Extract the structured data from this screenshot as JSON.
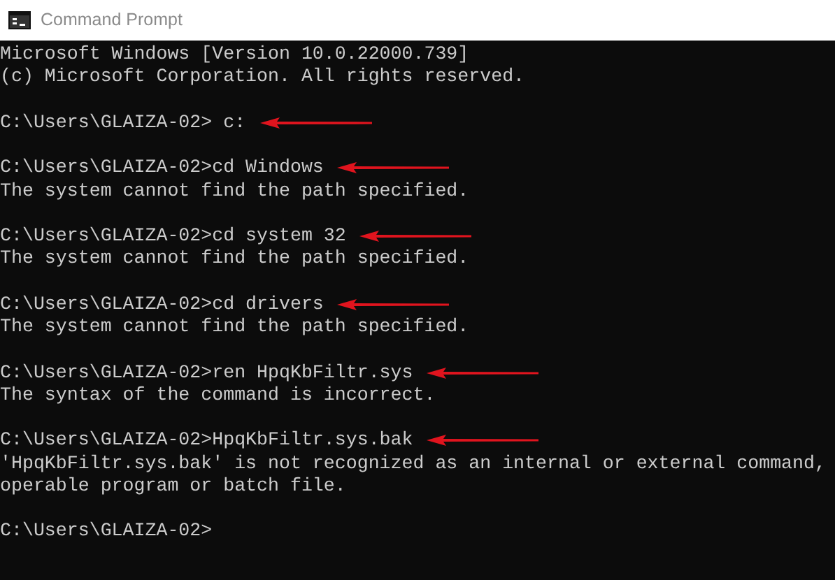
{
  "window": {
    "title": "Command Prompt"
  },
  "console": {
    "lines": [
      {
        "kind": "output",
        "text": "Microsoft Windows [Version 10.0.22000.739]",
        "arrow": false
      },
      {
        "kind": "output",
        "text": "(c) Microsoft Corporation. All rights reserved.",
        "arrow": false
      },
      {
        "kind": "blank"
      },
      {
        "kind": "command",
        "text": "C:\\Users\\GLAIZA-02> c:",
        "arrow": true
      },
      {
        "kind": "blank"
      },
      {
        "kind": "command",
        "text": "C:\\Users\\GLAIZA-02>cd Windows",
        "arrow": true
      },
      {
        "kind": "output",
        "text": "The system cannot find the path specified.",
        "arrow": false
      },
      {
        "kind": "blank"
      },
      {
        "kind": "command",
        "text": "C:\\Users\\GLAIZA-02>cd system 32",
        "arrow": true
      },
      {
        "kind": "output",
        "text": "The system cannot find the path specified.",
        "arrow": false
      },
      {
        "kind": "blank"
      },
      {
        "kind": "command",
        "text": "C:\\Users\\GLAIZA-02>cd drivers",
        "arrow": true
      },
      {
        "kind": "output",
        "text": "The system cannot find the path specified.",
        "arrow": false
      },
      {
        "kind": "blank"
      },
      {
        "kind": "command",
        "text": "C:\\Users\\GLAIZA-02>ren HpqKbFiltr.sys",
        "arrow": true
      },
      {
        "kind": "output",
        "text": "The syntax of the command is incorrect.",
        "arrow": false
      },
      {
        "kind": "blank"
      },
      {
        "kind": "command",
        "text": "C:\\Users\\GLAIZA-02>HpqKbFiltr.sys.bak",
        "arrow": true
      },
      {
        "kind": "output",
        "text": "'HpqKbFiltr.sys.bak' is not recognized as an internal or external command,",
        "arrow": false
      },
      {
        "kind": "output",
        "text": "operable program or batch file.",
        "arrow": false
      },
      {
        "kind": "blank"
      },
      {
        "kind": "command",
        "text": "C:\\Users\\GLAIZA-02>",
        "arrow": false
      }
    ]
  }
}
